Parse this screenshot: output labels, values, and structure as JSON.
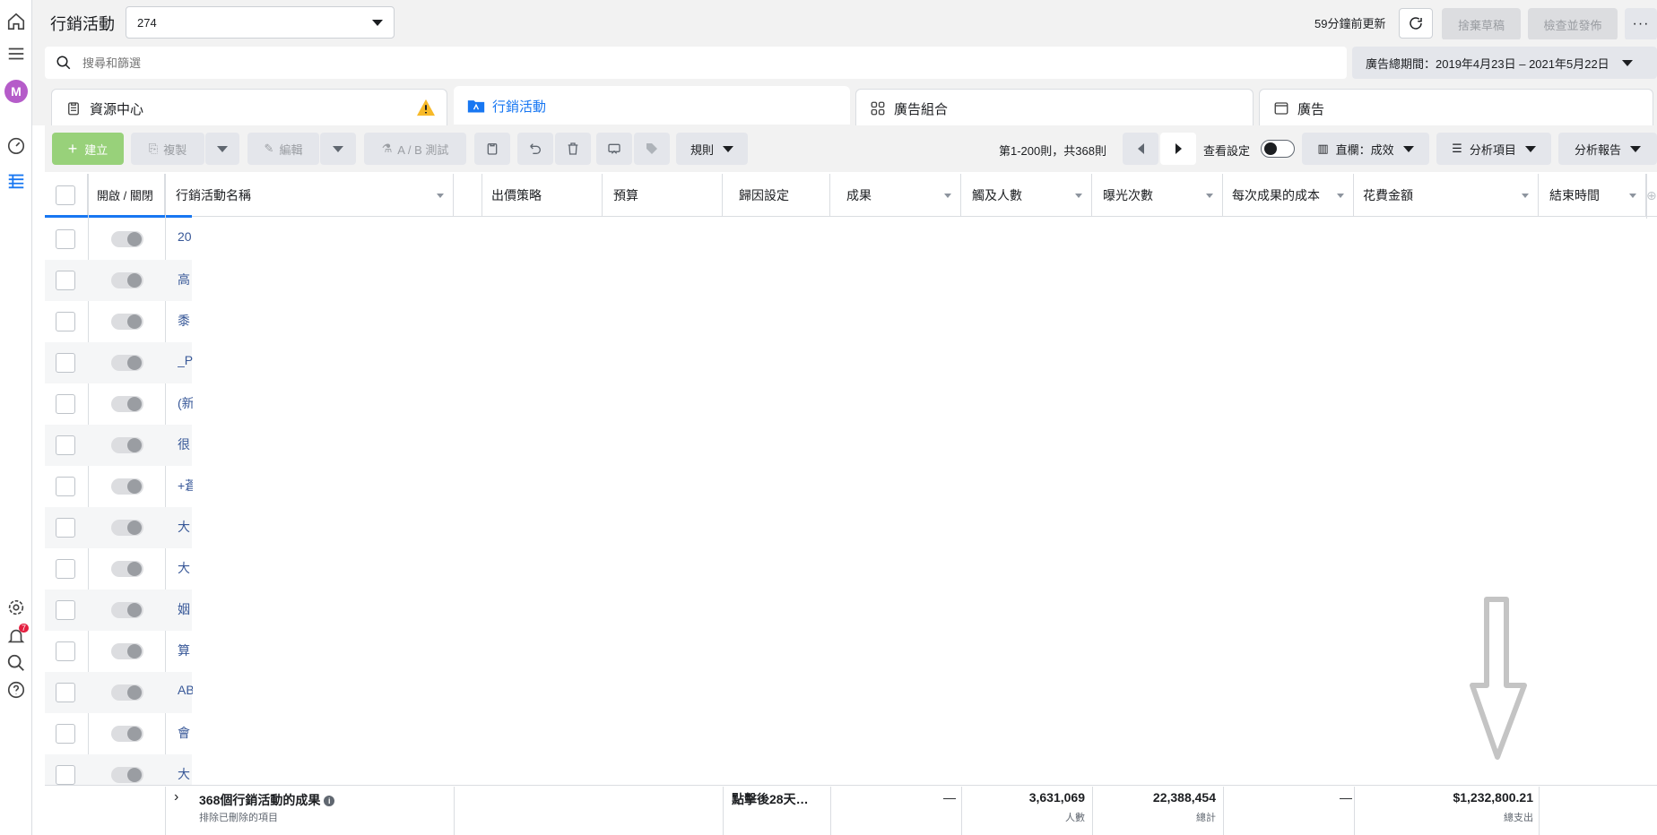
{
  "header": {
    "title": "行銷活動",
    "account_value": "274",
    "updated": "59分鐘前更新",
    "discard_label": "捨棄草稿",
    "publish_label": "檢查並發佈",
    "more_label": "···"
  },
  "search": {
    "placeholder": "搜尋和篩選",
    "date_range": "廣告總期間：2019年4月23日 – 2021年5月22日"
  },
  "tabs": [
    {
      "label": "資源中心"
    },
    {
      "label": "行銷活動"
    },
    {
      "label": "廣告組合"
    },
    {
      "label": "廣告"
    }
  ],
  "toolbar": {
    "create_label": "建立",
    "duplicate_label": "複製",
    "edit_label": "編輯",
    "abtest_label": "A / B 測試",
    "rules_label": "規則",
    "pagination": "第1-200則，共368則",
    "view_settings": "查看設定",
    "columns_label": "直欄：成效",
    "breakdown_label": "分析項目",
    "reports_label": "分析報告"
  },
  "columns": [
    {
      "label": "開啟 / 關閉"
    },
    {
      "label": "行銷活動名稱"
    },
    {
      "label": "出價策略"
    },
    {
      "label": "預算"
    },
    {
      "label": "歸因設定"
    },
    {
      "label": "成果"
    },
    {
      "label": "觸及人數"
    },
    {
      "label": "曝光次數"
    },
    {
      "label": "每次成果的成本"
    },
    {
      "label": "花費金額"
    },
    {
      "label": "結束時間"
    }
  ],
  "rows": [
    "20",
    "高",
    "黍",
    "_Pe",
    "(新",
    "很",
    "+蒼",
    "大",
    "大",
    "姻",
    "算",
    "AB",
    "會",
    "大"
  ],
  "footer": {
    "summary": "368個行銷活動的成果",
    "summary_sub": "排除已刪除的項目",
    "attribution": "點擊後28天…",
    "results": "—",
    "reach": "3,631,069",
    "reach_sub": "人數",
    "impressions": "22,388,454",
    "impressions_sub": "總計",
    "cost_per_result": "—",
    "spend": "$1,232,800.21",
    "spend_sub": "總支出"
  },
  "rail": {
    "avatar_letter": "M",
    "notification_count": "7"
  }
}
